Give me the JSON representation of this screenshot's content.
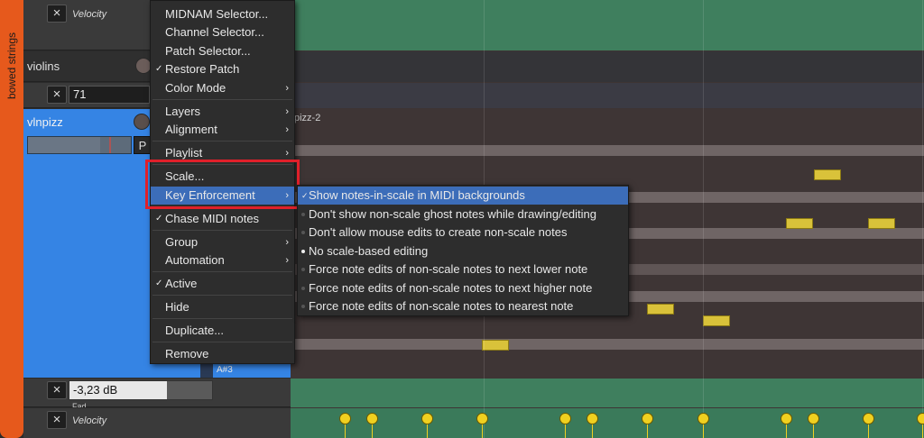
{
  "group_tab": {
    "label": "bowed strings"
  },
  "tracks": {
    "velocity_top": "Velocity",
    "violins": "violins",
    "violins_value": "71",
    "vlnpizz": "vlnpizz",
    "vlnpizz_button": "P",
    "key_label": "A#3",
    "gain_value": "-3,23 dB",
    "gain_cut": "Fad",
    "velocity_bottom": "Velocity"
  },
  "region": {
    "name": "pizz-2"
  },
  "context_menu": {
    "items": [
      {
        "label": "MIDNAM Selector...",
        "checked": false,
        "submenu": false
      },
      {
        "label": "Channel Selector...",
        "checked": false,
        "submenu": false
      },
      {
        "label": "Patch Selector...",
        "checked": false,
        "submenu": false
      },
      {
        "label": "Restore Patch",
        "checked": true,
        "submenu": false
      },
      {
        "label": "Color Mode",
        "checked": false,
        "submenu": true
      },
      {
        "label": "Layers",
        "checked": false,
        "submenu": true
      },
      {
        "label": "Alignment",
        "checked": false,
        "submenu": true
      },
      {
        "label": "Playlist",
        "checked": false,
        "submenu": true
      },
      {
        "label": "Scale...",
        "checked": false,
        "submenu": false
      },
      {
        "label": "Key Enforcement",
        "checked": false,
        "submenu": true
      },
      {
        "label": "Chase MIDI notes",
        "checked": true,
        "submenu": false
      },
      {
        "label": "Group",
        "checked": false,
        "submenu": true
      },
      {
        "label": "Automation",
        "checked": false,
        "submenu": true
      },
      {
        "label": "Active",
        "checked": true,
        "submenu": false
      },
      {
        "label": "Hide",
        "checked": false,
        "submenu": false
      },
      {
        "label": "Duplicate...",
        "checked": false,
        "submenu": false
      },
      {
        "label": "Remove",
        "checked": false,
        "submenu": false
      }
    ],
    "check_mark": "✓",
    "arrow": "›"
  },
  "key_enforcement_submenu": {
    "items": [
      {
        "label": "Show notes-in-scale in MIDI backgrounds",
        "kind": "check",
        "checked": true
      },
      {
        "label": "Don't show non-scale ghost notes while drawing/editing",
        "kind": "radio",
        "checked": false
      },
      {
        "label": "Don't allow mouse edits to create non-scale notes",
        "kind": "radio",
        "checked": false
      },
      {
        "label": "No scale-based editing",
        "kind": "radio",
        "checked": true
      },
      {
        "label": "Force note edits of non-scale notes to next lower note",
        "kind": "radio",
        "checked": false
      },
      {
        "label": "Force note edits of non-scale notes to next higher note",
        "kind": "radio",
        "checked": false
      },
      {
        "label": "Force note edits of non-scale notes to nearest note",
        "kind": "radio",
        "checked": false
      }
    ]
  },
  "colors": {
    "group_tab": "#e6591c",
    "selected_track": "#3584e4",
    "menu_highlight": "#3c6db9",
    "midi_note": "#d9c23a",
    "automation_lane": "#3f7f5e",
    "highlight_box": "#e0202a"
  },
  "icons": {
    "close": "×"
  }
}
